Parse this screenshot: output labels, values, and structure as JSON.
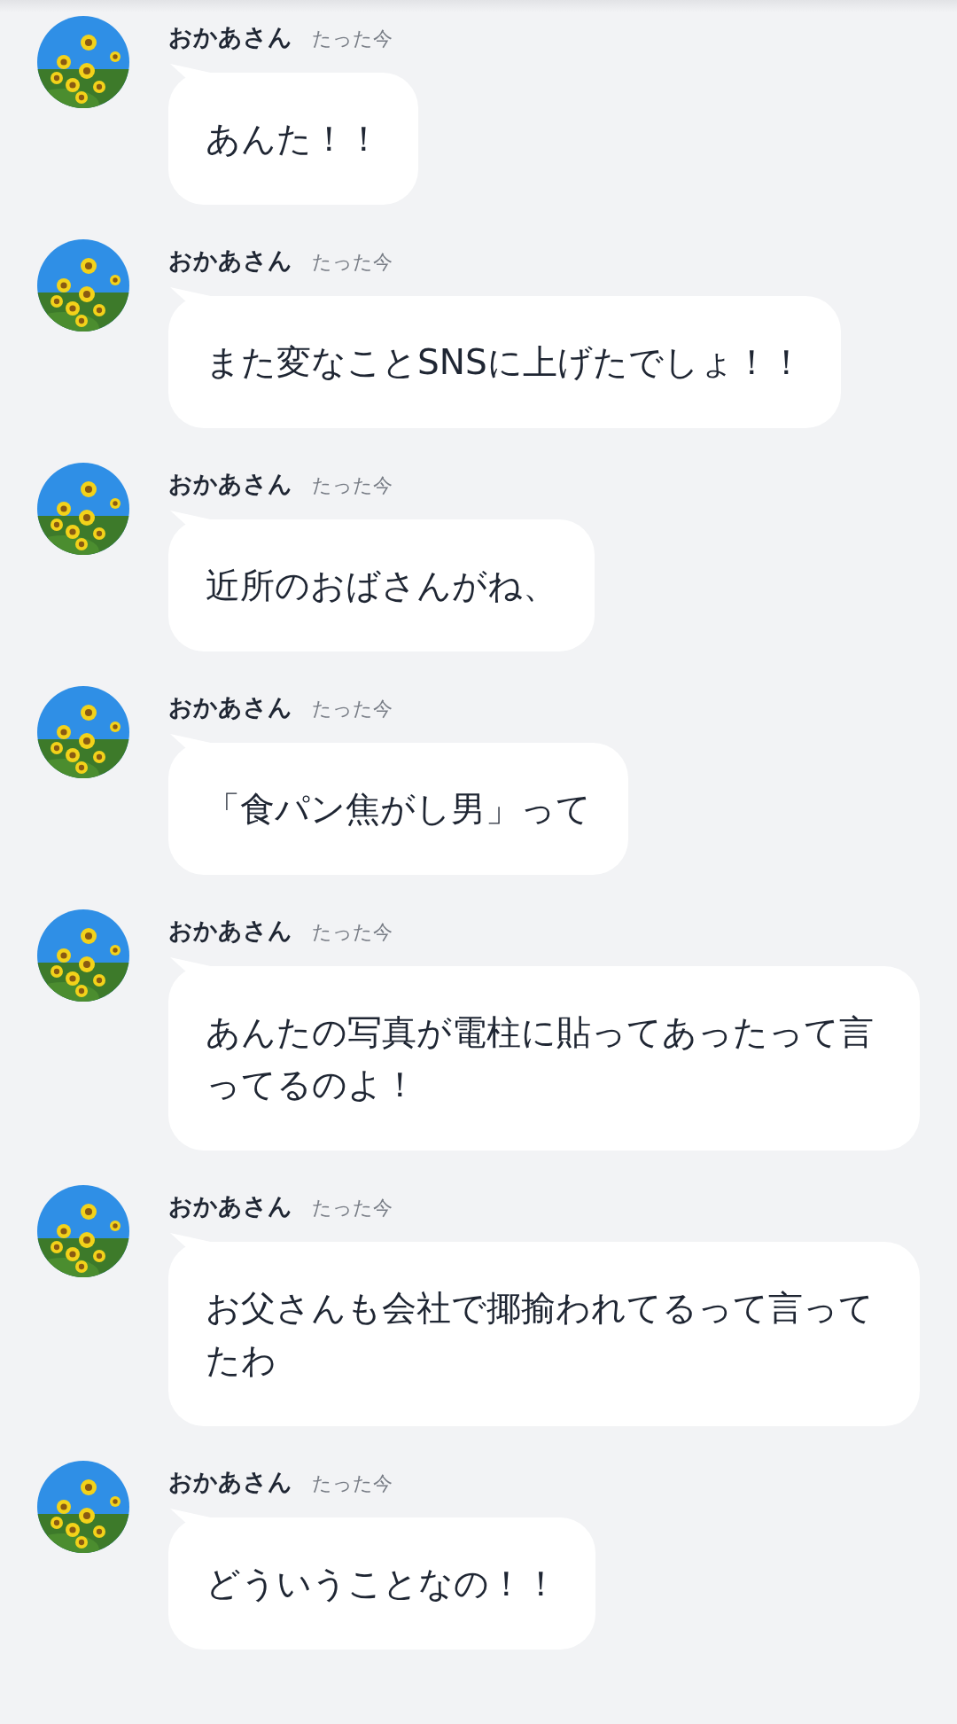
{
  "messages": [
    {
      "sender": "おかあさん",
      "time": "たった今",
      "text": "あんた！！"
    },
    {
      "sender": "おかあさん",
      "time": "たった今",
      "text": "また変なことSNSに上げたでしょ！！"
    },
    {
      "sender": "おかあさん",
      "time": "たった今",
      "text": "近所のおばさんがね、"
    },
    {
      "sender": "おかあさん",
      "time": "たった今",
      "text": "「食パン焦がし男」って"
    },
    {
      "sender": "おかあさん",
      "time": "たった今",
      "text": "あんたの写真が電柱に貼ってあったって言ってるのよ！"
    },
    {
      "sender": "おかあさん",
      "time": "たった今",
      "text": "お父さんも会社で揶揄われてるって言ってたわ"
    },
    {
      "sender": "おかあさん",
      "time": "たった今",
      "text": "どういうことなの！！"
    }
  ]
}
